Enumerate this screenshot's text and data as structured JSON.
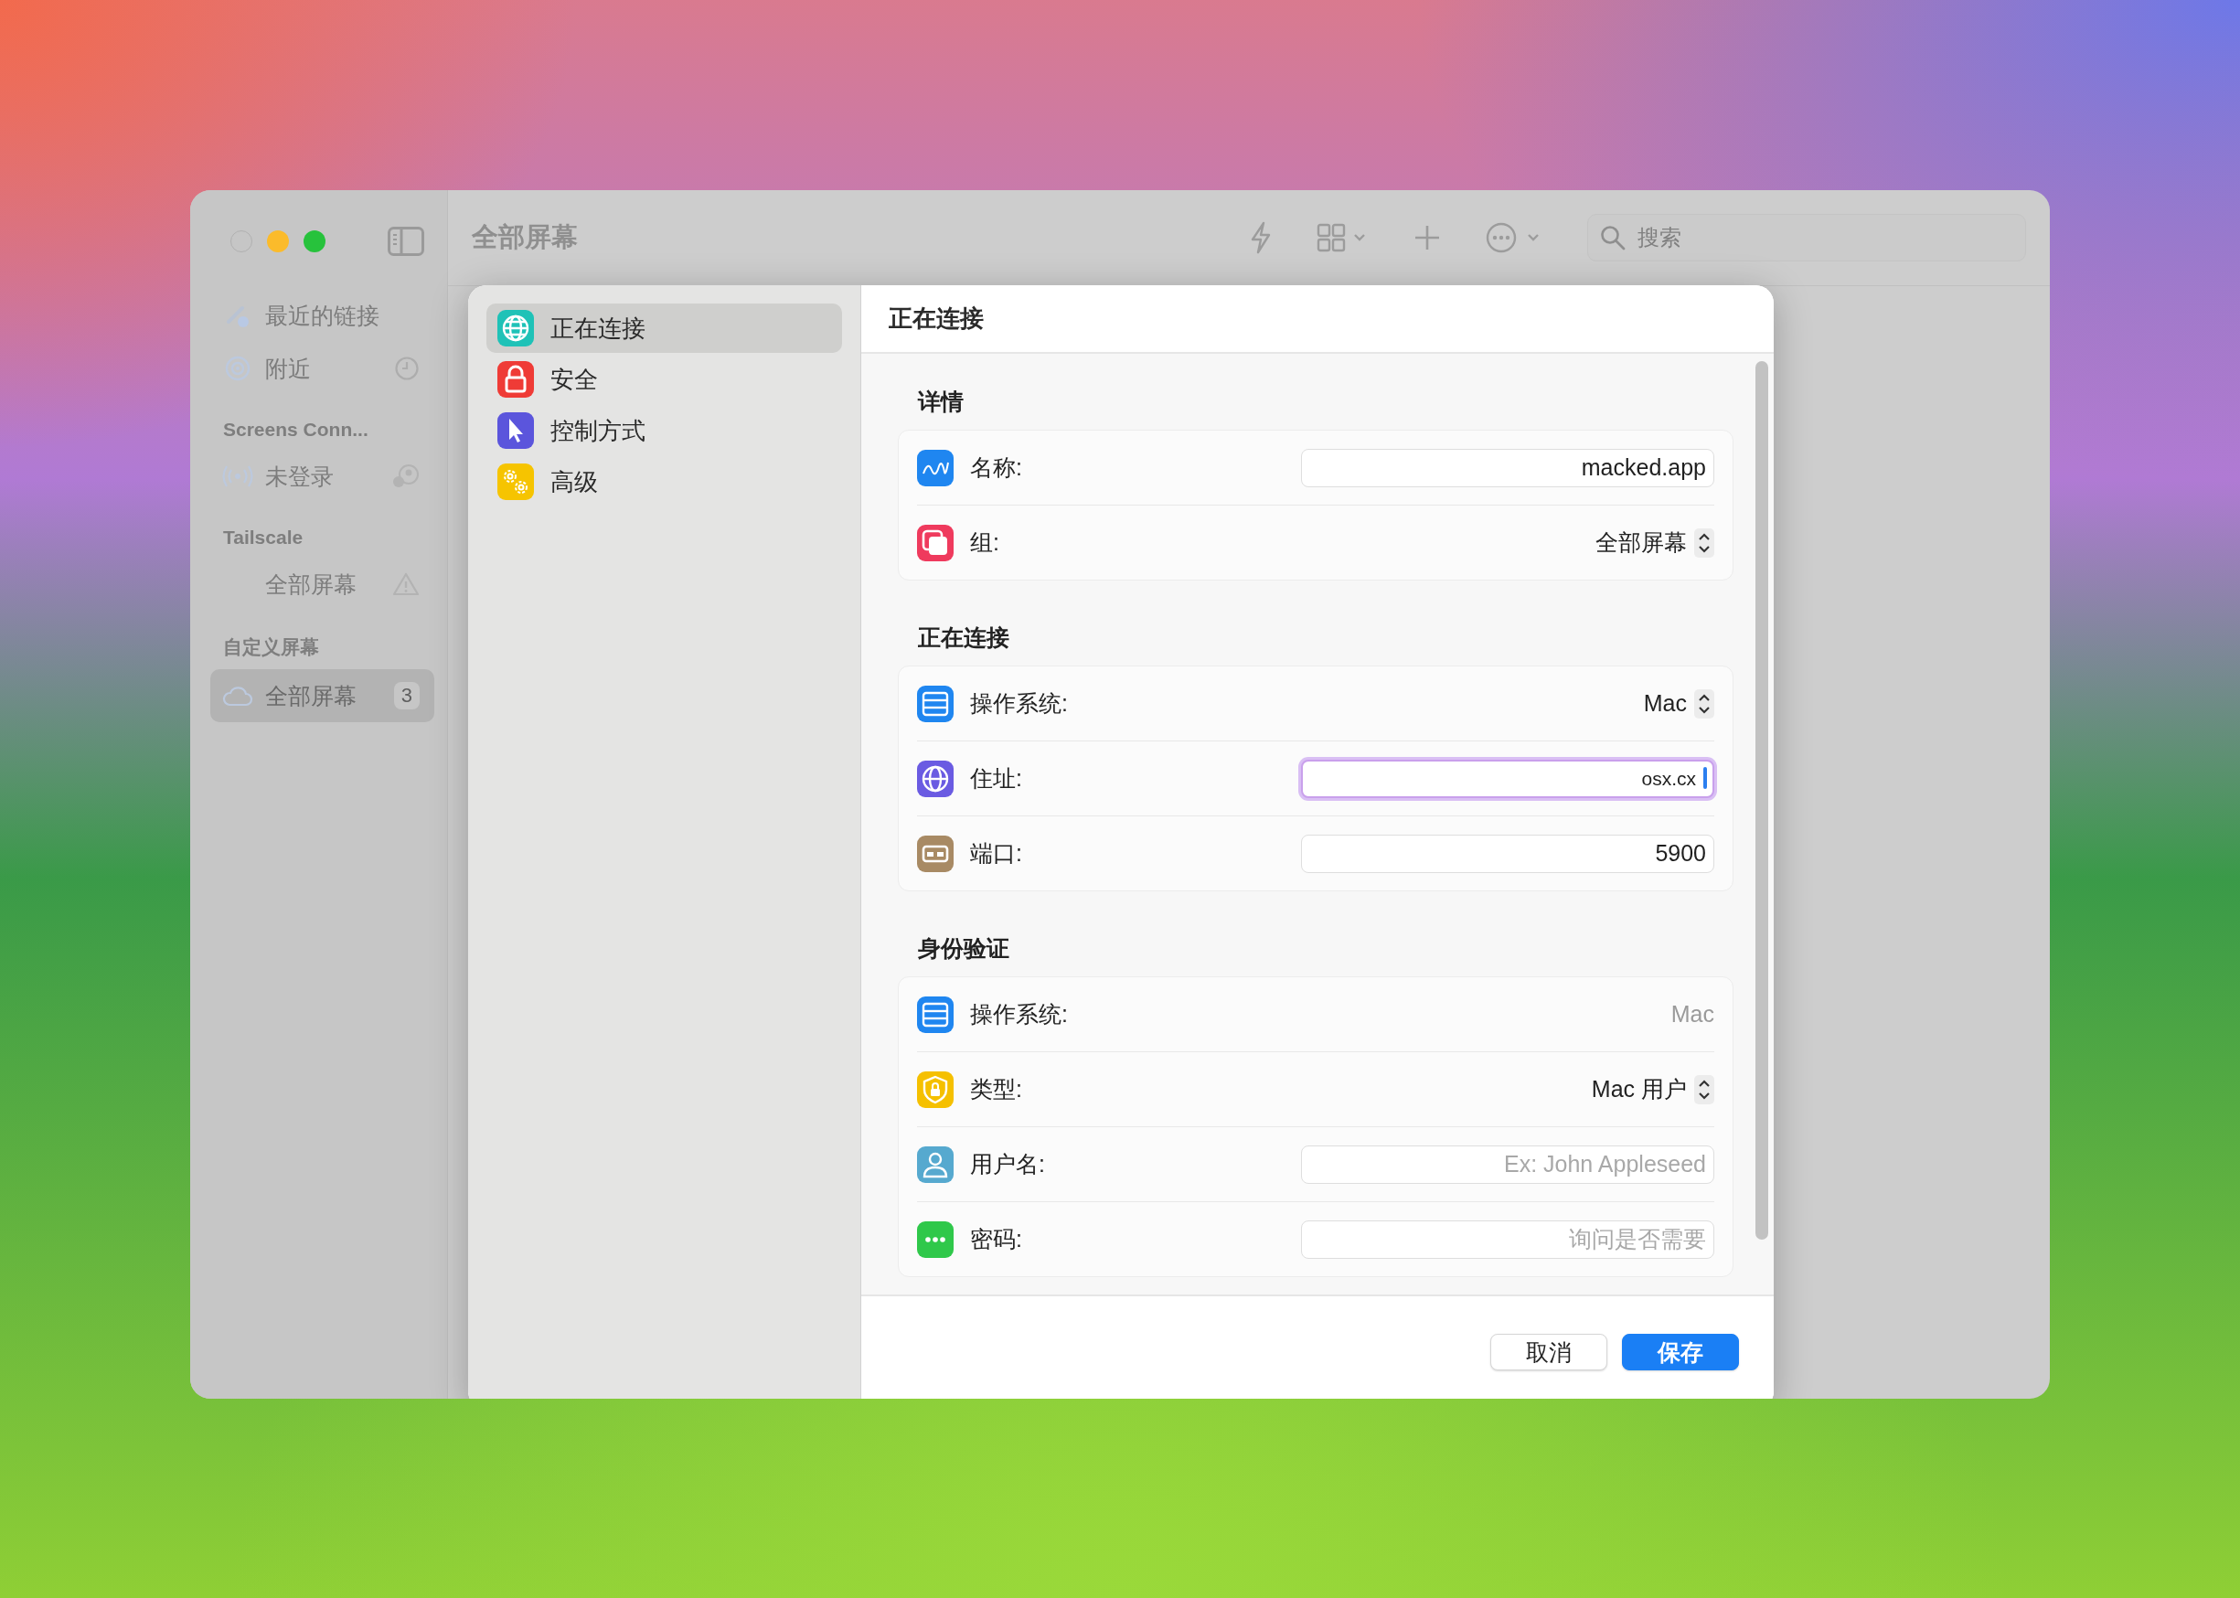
{
  "window": {
    "title": "全部屏幕",
    "search": {
      "placeholder": "搜索"
    }
  },
  "sidebar": {
    "groups": [
      {
        "items": [
          {
            "label": "最近的链接",
            "selected": false
          },
          {
            "label": "附近",
            "selected": false
          }
        ]
      },
      {
        "title": "Screens Conn...",
        "items": [
          {
            "label": "未登录",
            "selected": false
          }
        ]
      },
      {
        "title": "Tailscale",
        "items": [
          {
            "label": "全部屏幕",
            "selected": false
          }
        ]
      },
      {
        "title": "自定义屏幕",
        "items": [
          {
            "label": "全部屏幕",
            "selected": true,
            "count": "3"
          }
        ]
      }
    ]
  },
  "sheet": {
    "nav": [
      {
        "label": "正在连接",
        "selected": true
      },
      {
        "label": "安全",
        "selected": false
      },
      {
        "label": "控制方式",
        "selected": false
      },
      {
        "label": "高级",
        "selected": false
      }
    ],
    "title": "正在连接",
    "sections": [
      {
        "heading": "详情",
        "rows": [
          {
            "kind": "text",
            "label": "名称:",
            "value": "macked.app",
            "focused": false
          },
          {
            "kind": "select",
            "label": "组:",
            "value": "全部屏幕"
          }
        ]
      },
      {
        "heading": "正在连接",
        "rows": [
          {
            "kind": "select",
            "label": "操作系统:",
            "value": "Mac"
          },
          {
            "kind": "text",
            "label": "住址:",
            "value": "osx.cx",
            "focused": true
          },
          {
            "kind": "text",
            "label": "端口:",
            "value": "5900",
            "focused": false
          }
        ]
      },
      {
        "heading": "身份验证",
        "rows": [
          {
            "kind": "static",
            "label": "操作系统:",
            "value": "Mac"
          },
          {
            "kind": "select",
            "label": "类型:",
            "value": "Mac 用户"
          },
          {
            "kind": "text",
            "label": "用户名:",
            "placeholder": "Ex: John Appleseed",
            "focused": false
          },
          {
            "kind": "text",
            "label": "密码:",
            "placeholder": "询问是否需要",
            "focused": false
          }
        ]
      }
    ],
    "buttons": [
      {
        "label": "取消",
        "kind": "cancel"
      },
      {
        "label": "保存",
        "kind": "primary"
      }
    ]
  }
}
